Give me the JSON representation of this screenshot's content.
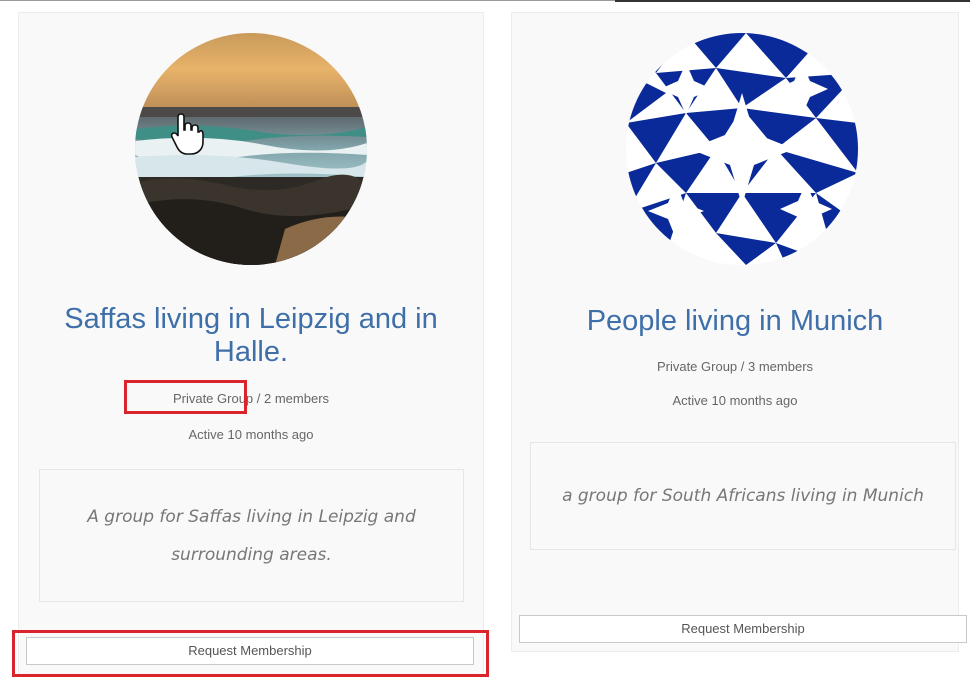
{
  "groups": [
    {
      "title": "Saffas living in Leipzig and in Halle.",
      "privacy": "Private Group",
      "separator": " / ",
      "members": "2 members",
      "activity": "Active 10 months ago",
      "description": "A group for Saffas living in Leipzig and surrounding areas.",
      "action_label": "Request Membership",
      "avatar": "beach-sunset-photo"
    },
    {
      "title": "People living in Munich",
      "privacy": "Private Group",
      "separator": " / ",
      "members": "3 members",
      "activity": "Active 10 months ago",
      "description": "a group for South Africans living in Munich",
      "action_label": "Request Membership",
      "avatar": "blue-star-pattern"
    }
  ],
  "colors": {
    "title": "#3f6fa8",
    "highlight": "#d9232d",
    "pattern_blue": "#0b2a99"
  }
}
